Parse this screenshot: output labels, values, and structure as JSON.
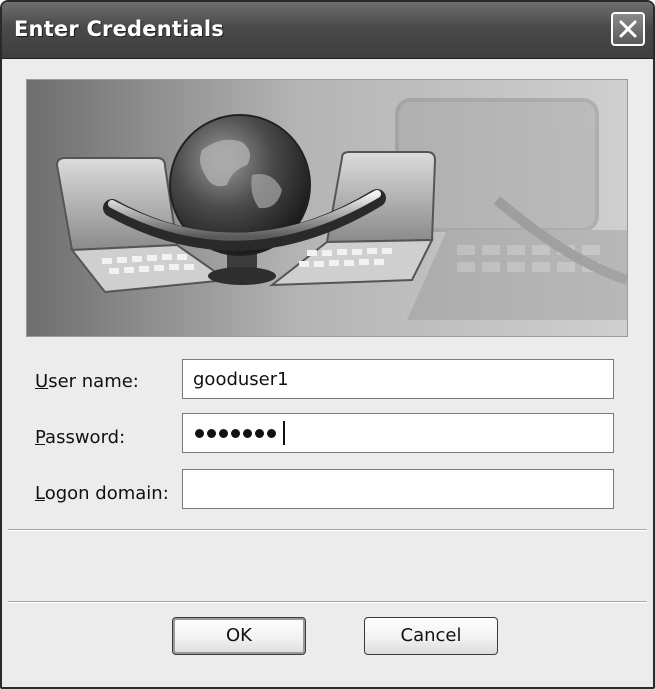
{
  "dialog": {
    "title": "Enter Credentials"
  },
  "icons": {
    "close": "close-icon",
    "banner": "network-globe-laptops-banner"
  },
  "form": {
    "username": {
      "label_prefix": "",
      "label_access": "U",
      "label_rest": "ser name:",
      "value": "gooduser1"
    },
    "password": {
      "label_prefix": "",
      "label_access": "P",
      "label_rest": "assword:",
      "masked_length": 7
    },
    "domain": {
      "label_prefix": "",
      "label_access": "L",
      "label_rest": "ogon domain:",
      "value": ""
    }
  },
  "buttons": {
    "ok": "OK",
    "cancel": "Cancel"
  }
}
